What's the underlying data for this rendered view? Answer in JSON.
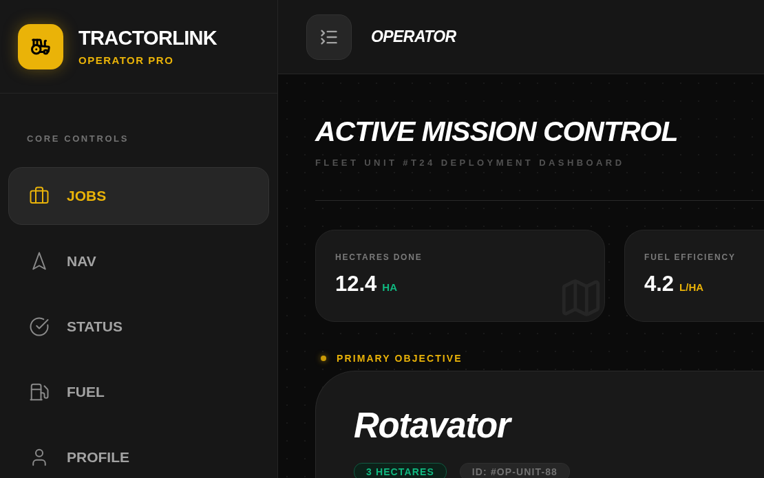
{
  "brand": {
    "name": "TRACTORLINK",
    "tagline": "OPERATOR PRO"
  },
  "sidebar": {
    "section_label": "CORE CONTROLS",
    "items": [
      {
        "label": "JOBS",
        "selected": true
      },
      {
        "label": "NAV",
        "selected": false
      },
      {
        "label": "STATUS",
        "selected": false
      },
      {
        "label": "FUEL",
        "selected": false
      },
      {
        "label": "PROFILE",
        "selected": false
      }
    ]
  },
  "topbar": {
    "title": "OPERATOR"
  },
  "page": {
    "title": "ACTIVE MISSION CONTROL",
    "subtitle": "FLEET UNIT #T24 DEPLOYMENT DASHBOARD"
  },
  "stats": [
    {
      "label": "HECTARES DONE",
      "value": "12.4",
      "unit": "HA",
      "color": "#10b981"
    },
    {
      "label": "FUEL EFFICIENCY",
      "value": "4.2",
      "unit": "L/HA",
      "color": "#eab308"
    }
  ],
  "objective": {
    "label": "PRIMARY OBJECTIVE",
    "title": "Rotavator",
    "tags": [
      {
        "text": "3 HECTARES",
        "kind": "area"
      },
      {
        "text": "ID: #OP-UNIT-88",
        "kind": "id"
      }
    ]
  }
}
